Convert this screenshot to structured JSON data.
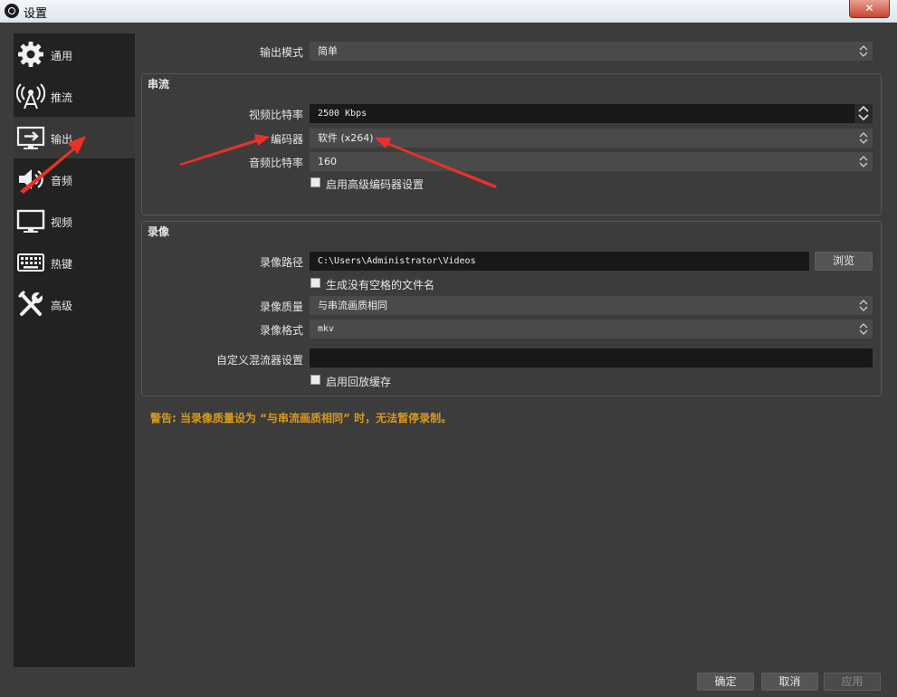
{
  "window": {
    "title": "设置"
  },
  "sidebar": {
    "items": [
      {
        "label": "通用"
      },
      {
        "label": "推流"
      },
      {
        "label": "输出"
      },
      {
        "label": "音频"
      },
      {
        "label": "视频"
      },
      {
        "label": "热键"
      },
      {
        "label": "高级"
      }
    ]
  },
  "output": {
    "mode_label": "输出模式",
    "mode_value": "简单"
  },
  "streaming": {
    "title": "串流",
    "video_bitrate_label": "视频比特率",
    "video_bitrate_value": "2500 Kbps",
    "encoder_label": "编码器",
    "encoder_value": "软件 (x264)",
    "audio_bitrate_label": "音频比特率",
    "audio_bitrate_value": "160",
    "advanced_encoder_label": "启用高级编码器设置"
  },
  "recording": {
    "title": "录像",
    "path_label": "录像路径",
    "path_value": "C:\\Users\\Administrator\\Videos",
    "browse_label": "浏览",
    "no_space_label": "生成没有空格的文件名",
    "quality_label": "录像质量",
    "quality_value": "与串流画质相同",
    "format_label": "录像格式",
    "format_value": "mkv",
    "muxer_label": "自定义混流器设置",
    "muxer_value": "",
    "replay_buffer_label": "启用回放缓存"
  },
  "warning": "警告: 当录像质量设为 “与串流画质相同” 时，无法暂停录制。",
  "footer": {
    "ok_label": "确定",
    "cancel_label": "取消",
    "apply_label": "应用"
  },
  "colors": {
    "background": "#3c3c3c",
    "sidebar": "#222222",
    "warning": "#d99a1b",
    "annotation_arrow": "#e8312a"
  }
}
